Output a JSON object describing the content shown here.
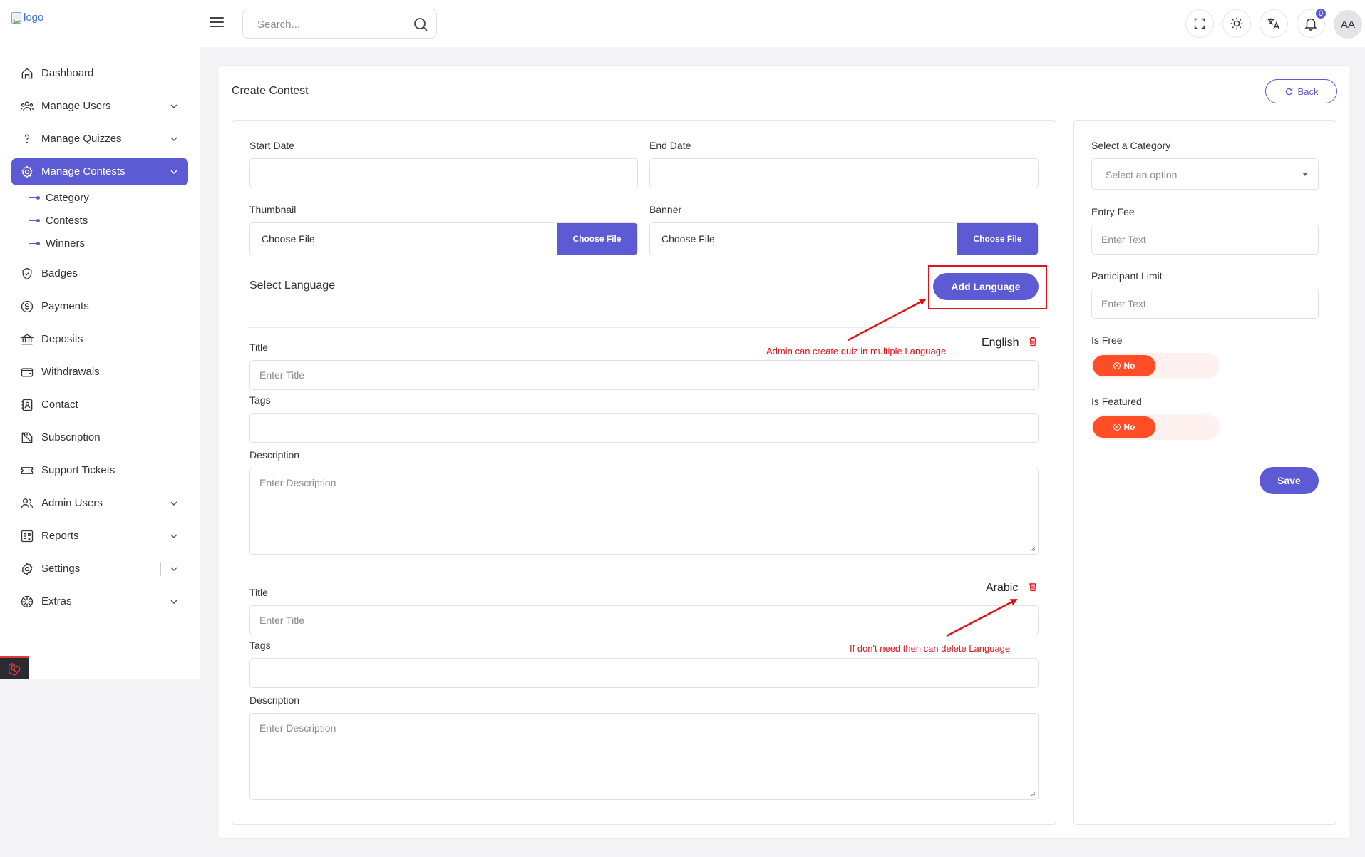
{
  "header": {
    "logo_alt": "logo",
    "search_placeholder": "Search...",
    "notification_count": "0",
    "avatar_initials": "AA"
  },
  "sidebar": {
    "items": [
      {
        "label": "Dashboard",
        "icon": "home-icon"
      },
      {
        "label": "Manage Users",
        "icon": "users-icon"
      },
      {
        "label": "Manage Quizzes",
        "icon": "question-icon"
      },
      {
        "label": "Manage Contests",
        "icon": "contest-gear-icon"
      },
      {
        "label": "Badges",
        "icon": "badge-icon"
      },
      {
        "label": "Payments",
        "icon": "dollar-icon"
      },
      {
        "label": "Deposits",
        "icon": "bank-icon"
      },
      {
        "label": "Withdrawals",
        "icon": "wallet-icon"
      },
      {
        "label": "Contact",
        "icon": "contact-icon"
      },
      {
        "label": "Subscription",
        "icon": "subscription-icon"
      },
      {
        "label": "Support Tickets",
        "icon": "ticket-icon"
      },
      {
        "label": "Admin Users",
        "icon": "admin-users-icon"
      },
      {
        "label": "Reports",
        "icon": "reports-icon"
      },
      {
        "label": "Settings",
        "icon": "gear-icon"
      },
      {
        "label": "Extras",
        "icon": "extras-icon"
      }
    ],
    "subitems": [
      "Category",
      "Contests",
      "Winners"
    ]
  },
  "page": {
    "title": "Create Contest",
    "back_label": "Back"
  },
  "form": {
    "start_date_label": "Start Date",
    "end_date_label": "End Date",
    "thumbnail_label": "Thumbnail",
    "banner_label": "Banner",
    "choose_file_text": "Choose File",
    "choose_file_button": "Choose File",
    "select_language_label": "Select Language",
    "add_language_label": "Add Language",
    "languages": [
      {
        "name": "English",
        "title_label": "Title",
        "title_placeholder": "Enter Title",
        "tags_label": "Tags",
        "description_label": "Description",
        "description_placeholder": "Enter Description"
      },
      {
        "name": "Arabic",
        "title_label": "Title",
        "title_placeholder": "Enter Title",
        "tags_label": "Tags",
        "description_label": "Description",
        "description_placeholder": "Enter Description"
      }
    ]
  },
  "annotations": {
    "multi_language": "Admin can create quiz in multiple Language",
    "delete_language": "If don't need then can delete Language"
  },
  "side_form": {
    "category_label": "Select a Category",
    "category_placeholder": "Select an option",
    "entry_fee_label": "Entry Fee",
    "entry_fee_placeholder": "Enter Text",
    "participant_limit_label": "Participant Limit",
    "participant_limit_placeholder": "Enter Text",
    "is_free_label": "Is Free",
    "is_free_value": "No",
    "is_featured_label": "Is Featured",
    "is_featured_value": "No",
    "save_label": "Save"
  },
  "colors": {
    "accent": "#5d5bd4",
    "toggle_off": "#ff4d26",
    "annotation": "#e0131a"
  }
}
